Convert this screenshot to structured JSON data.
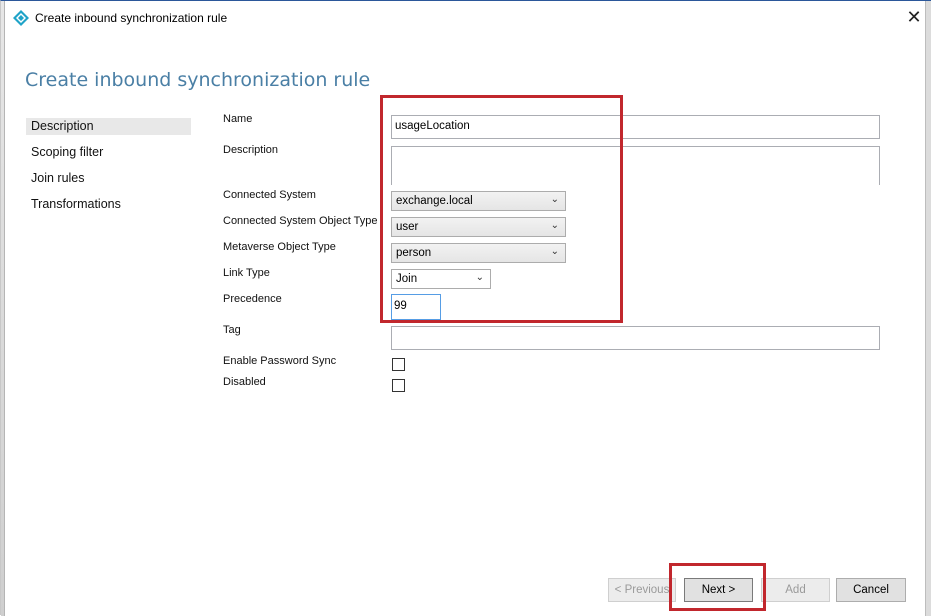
{
  "window": {
    "title": "Create inbound synchronization rule",
    "close_glyph": "✕"
  },
  "page": {
    "heading": "Create inbound synchronization rule"
  },
  "nav": {
    "items": [
      {
        "label": "Description",
        "active": true
      },
      {
        "label": "Scoping filter",
        "active": false
      },
      {
        "label": "Join rules",
        "active": false
      },
      {
        "label": "Transformations",
        "active": false
      }
    ]
  },
  "form": {
    "name_label": "Name",
    "name_value": "usageLocation",
    "description_label": "Description",
    "description_value": "",
    "connected_system_label": "Connected System",
    "connected_system_value": "exchange.local",
    "cs_object_type_label": "Connected System Object Type",
    "cs_object_type_value": "user",
    "mv_object_type_label": "Metaverse Object Type",
    "mv_object_type_value": "person",
    "link_type_label": "Link Type",
    "link_type_value": "Join",
    "precedence_label": "Precedence",
    "precedence_value": "99",
    "tag_label": "Tag",
    "tag_value": "",
    "enable_password_sync_label": "Enable Password Sync",
    "enable_password_sync_checked": false,
    "disabled_label": "Disabled",
    "disabled_checked": false
  },
  "buttons": {
    "previous": "< Previous",
    "next": "Next >",
    "add": "Add",
    "cancel": "Cancel"
  },
  "icons": {
    "app": "app-diamond-icon",
    "dropdown": "chevron-down-icon"
  },
  "colors": {
    "heading": "#4a7fa5",
    "highlight_box": "#c1272d",
    "focus_border": "#569de5"
  }
}
